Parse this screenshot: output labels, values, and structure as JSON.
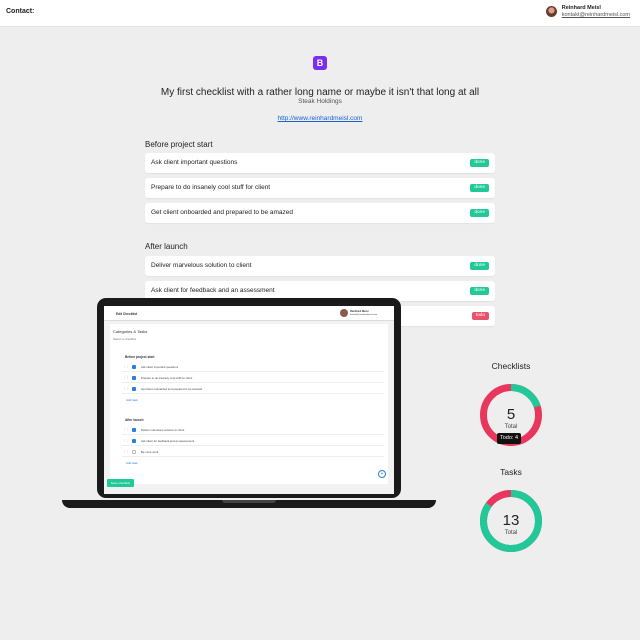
{
  "header": {
    "contact_label": "Contact:",
    "user_name": "Reinhard Meisl",
    "user_email": "kontakt@reinhardmeisl.com"
  },
  "logo": {
    "letter": "B",
    "color": "#7a2ff0"
  },
  "checklist": {
    "title": "My first checklist with a rather long name or maybe it isn't that long at all",
    "company": "Steak Holdings",
    "url": "http://www.reinhardmeisl.com"
  },
  "sections": [
    {
      "name": "Before project start",
      "items": [
        {
          "label": "Ask client important questions",
          "status": "done"
        },
        {
          "label": "Prepare to do insanely cool stuff for client",
          "status": "done"
        },
        {
          "label": "Get client onboarded and prepared to be amazed",
          "status": "done"
        }
      ]
    },
    {
      "name": "After launch",
      "items": [
        {
          "label": "Deliver marvelous solution to client",
          "status": "done"
        },
        {
          "label": "Ask client for feedback and an assessment",
          "status": "done"
        },
        {
          "label": "",
          "status": "todo"
        }
      ]
    }
  ],
  "laptop": {
    "header_title": "Edit Checklist",
    "user_name": "Reinhard Meisl",
    "user_email": "kontakt@reinhardmeisl.com",
    "card_title": "Categories & Tasks",
    "card_subtitle": "Select a checklist",
    "cat1": "Before project start",
    "cat1_items": [
      "Ask client important questions",
      "Prepare to do insanely cool stuff for client",
      "Get client onboarded and prepared to be amazed"
    ],
    "add_task": "Add task",
    "cat2": "After launch",
    "cat2_items": [
      "Deliver marvelous solution to client",
      "Ask client for feedback and an assessment",
      "Be more work"
    ],
    "save_label": "Save checklist"
  },
  "stats": {
    "checklists": {
      "title": "Checklists",
      "value": "5",
      "sub": "Total",
      "done_fraction": 0.2,
      "tooltip": "Todo: 4"
    },
    "tasks": {
      "title": "Tasks",
      "value": "13",
      "sub": "Total",
      "done_fraction": 0.85
    },
    "colors": {
      "done": "#20c997",
      "todo": "#e8365d"
    }
  }
}
